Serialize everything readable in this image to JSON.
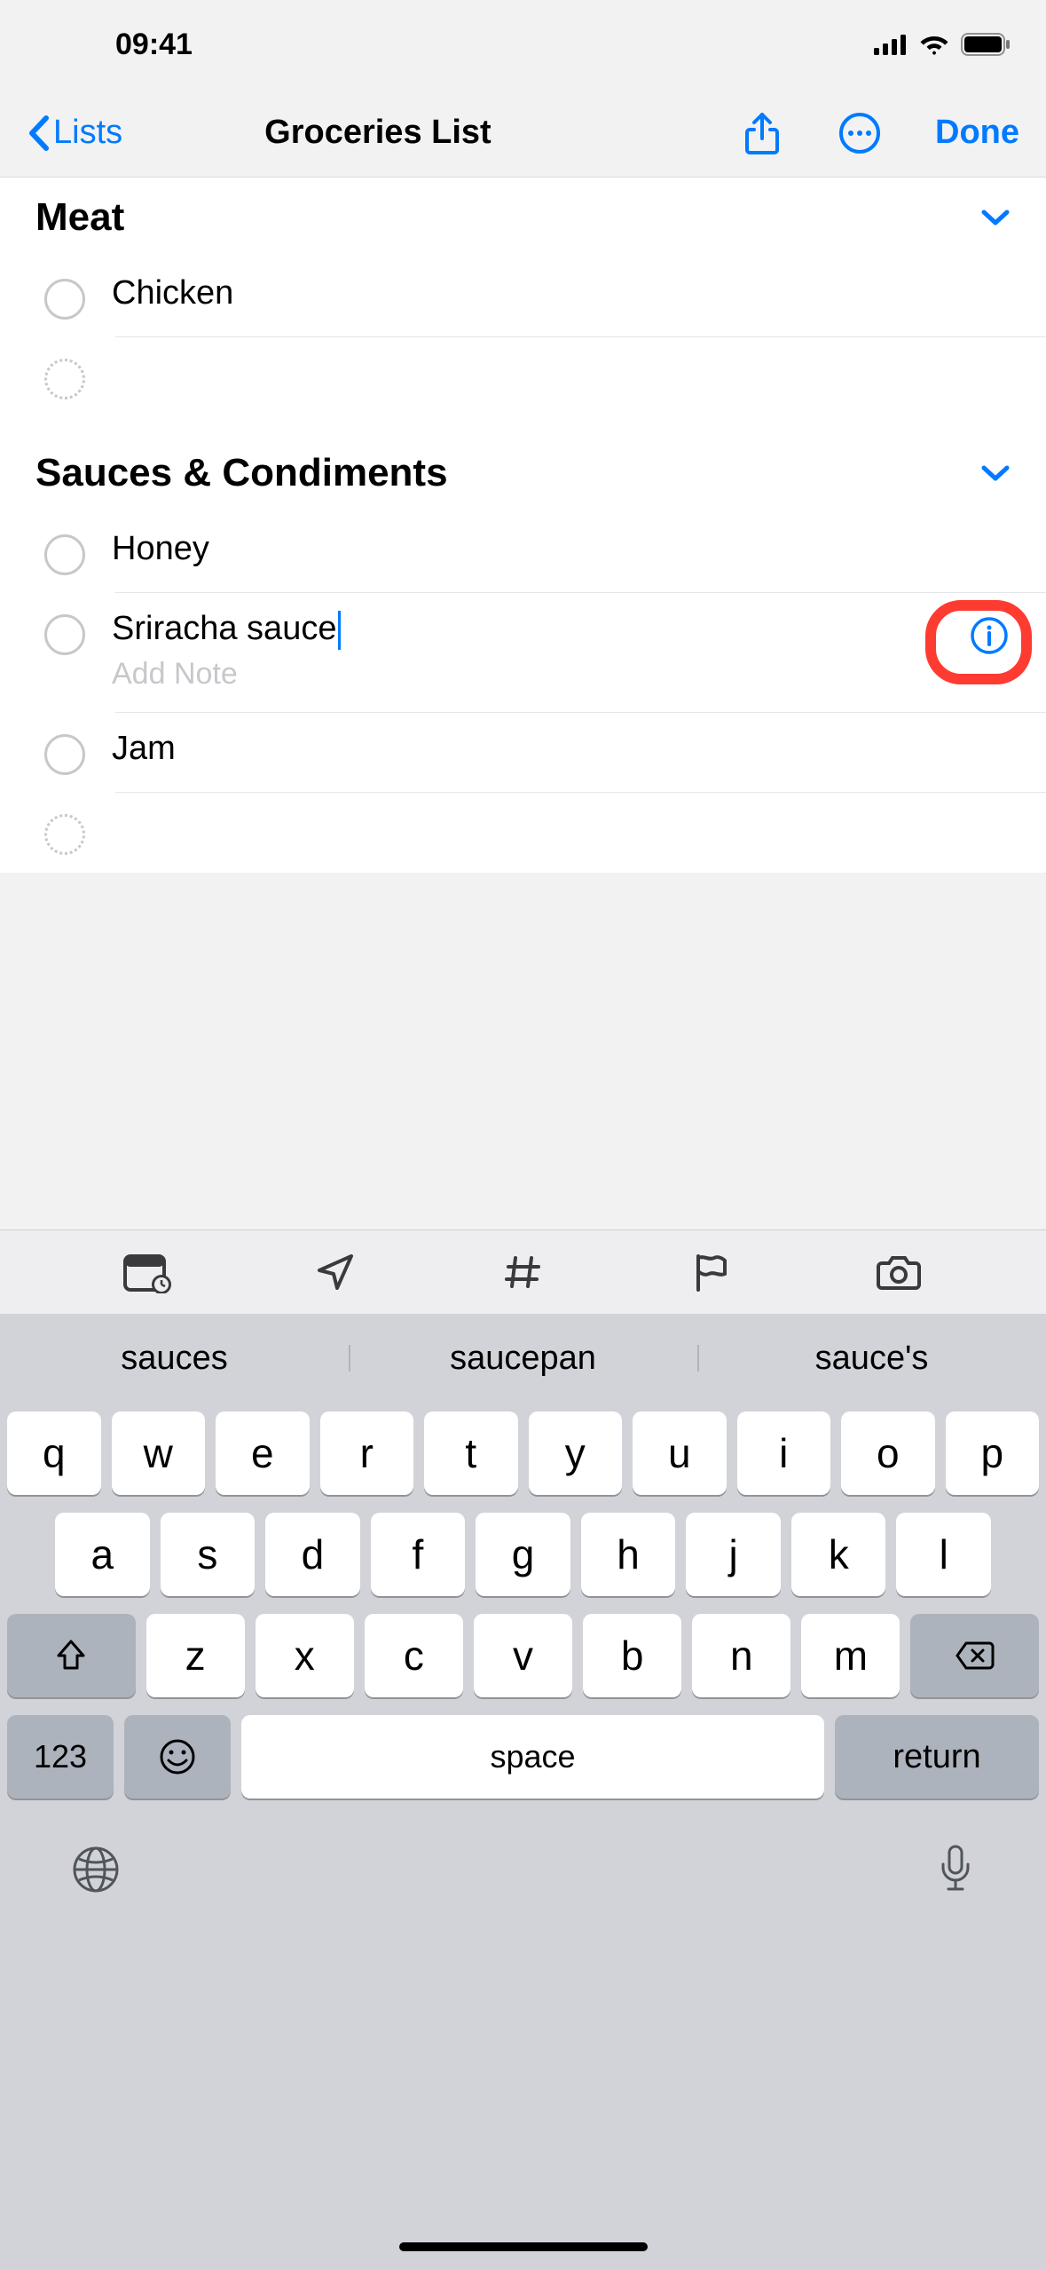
{
  "status": {
    "time": "09:41"
  },
  "nav": {
    "back_label": "Lists",
    "title": "Groceries List",
    "done_label": "Done"
  },
  "sections": [
    {
      "title": "Meat",
      "items": [
        {
          "label": "Chicken",
          "editing": false,
          "has_info": false
        }
      ]
    },
    {
      "title": "Sauces & Condiments",
      "items": [
        {
          "label": "Honey",
          "editing": false,
          "has_info": false
        },
        {
          "label": "Sriracha sauce",
          "editing": true,
          "note_placeholder": "Add Note",
          "has_info": true
        },
        {
          "label": "Jam",
          "editing": false,
          "has_info": false
        }
      ]
    }
  ],
  "keyboard": {
    "suggestions": [
      "sauces",
      "saucepan",
      "sauce's"
    ],
    "rows": [
      [
        "q",
        "w",
        "e",
        "r",
        "t",
        "y",
        "u",
        "i",
        "o",
        "p"
      ],
      [
        "a",
        "s",
        "d",
        "f",
        "g",
        "h",
        "j",
        "k",
        "l"
      ],
      [
        "z",
        "x",
        "c",
        "v",
        "b",
        "n",
        "m"
      ]
    ],
    "numkey": "123",
    "space": "space",
    "return": "return"
  }
}
